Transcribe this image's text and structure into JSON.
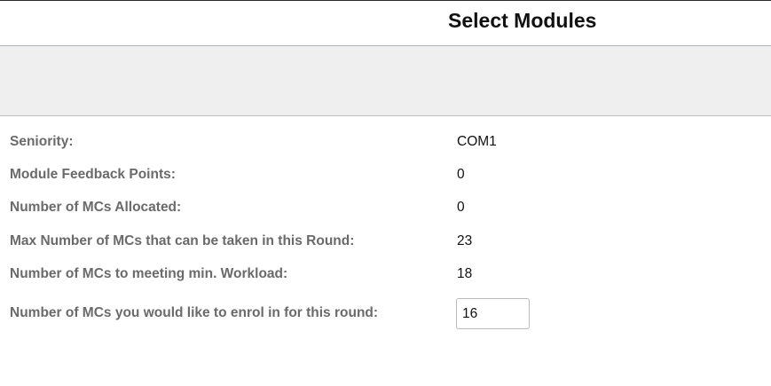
{
  "header": {
    "title": "Select Modules"
  },
  "details": {
    "seniority": {
      "label": "Seniority:",
      "value": "COM1"
    },
    "feedback_points": {
      "label": "Module Feedback Points:",
      "value": "0"
    },
    "mcs_allocated": {
      "label": "Number of MCs Allocated:",
      "value": "0"
    },
    "max_mcs": {
      "label": "Max Number of MCs that can be taken in this Round:",
      "value": "23"
    },
    "min_workload": {
      "label": "Number of MCs to meeting min. Workload:",
      "value": "18"
    }
  },
  "enrol": {
    "label": "Number of MCs you would like to enrol in for this round:",
    "value": "16"
  }
}
